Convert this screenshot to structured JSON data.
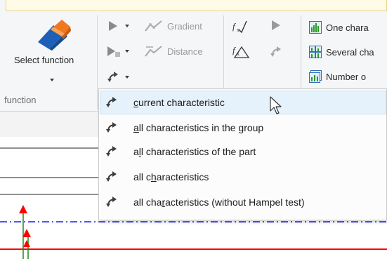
{
  "ribbon": {
    "select_function_label": "Select function",
    "group_label": "function",
    "gradient_label": "Gradient",
    "distance_label": "Distance",
    "one_char_label": "One chara",
    "several_char_label": "Several cha",
    "number_of_label": "Number o"
  },
  "menu": {
    "items": [
      {
        "pre": "",
        "key": "c",
        "post": "urrent characteristic",
        "hovered": true
      },
      {
        "pre": "",
        "key": "a",
        "post": "ll characteristics in the group",
        "hovered": false
      },
      {
        "pre": "a",
        "key": "l",
        "post": "l characteristics of the part",
        "hovered": false
      },
      {
        "pre": "all c",
        "key": "h",
        "post": "aracteristics",
        "hovered": false
      },
      {
        "pre": "all cha",
        "key": "r",
        "post": "acteristics (without Hampel test)",
        "hovered": false
      }
    ]
  },
  "colors": {
    "ribbon_bg": "#f5f6f7",
    "menu_hover": "#e5f1fb",
    "limit_red": "#ff0000",
    "dashdot_blue": "#1a1aff",
    "marker_red": "#ff0000",
    "marker_green": "#1a8a1a"
  }
}
